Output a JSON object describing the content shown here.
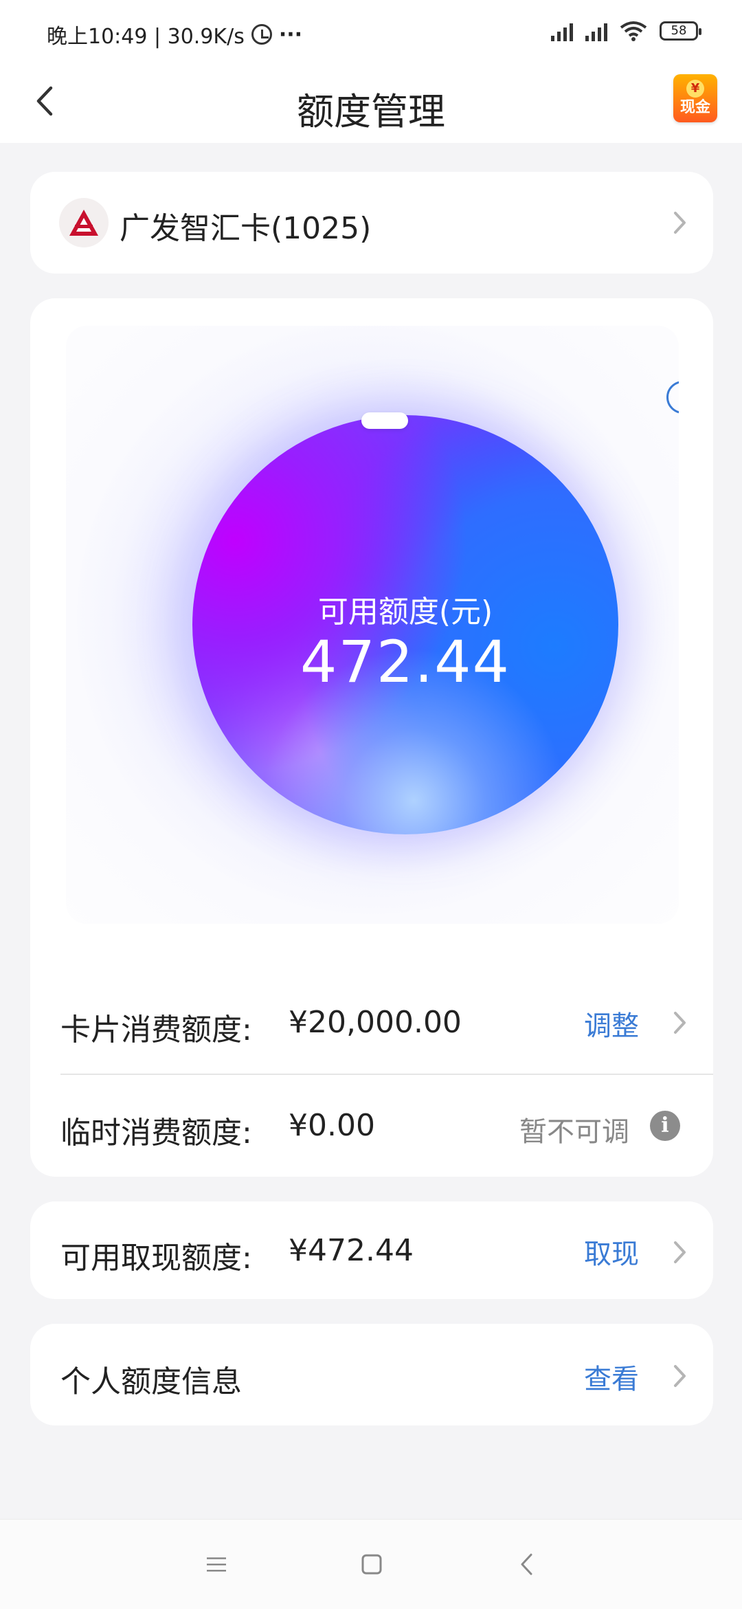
{
  "status_bar": {
    "time_speed": "晚上10:49 | 30.9K/s",
    "more": "···",
    "battery": "58",
    "icons": [
      "alarm-icon",
      "signal-icon",
      "signal-icon",
      "wifi-icon",
      "battery-icon"
    ]
  },
  "header": {
    "title": "额度管理",
    "back_icon": "chevron-left-icon",
    "cash_badge": {
      "coin": "¥",
      "label": "现金"
    }
  },
  "card_selector": {
    "bank_name": "广发智汇卡(1025)",
    "logo_icon": "cgb-bank-logo"
  },
  "credit_ball": {
    "label": "可用额度(元)",
    "value": "472.44",
    "help_icon": "?"
  },
  "limits": [
    {
      "label": "卡片消费额度:",
      "value": "¥20,000.00",
      "action": "调整"
    },
    {
      "label": "临时消费额度:",
      "value": "¥0.00",
      "action": "暂不可调",
      "info_icon": "i"
    }
  ],
  "cash_withdrawal": {
    "label": "可用取现额度:",
    "value": "¥472.44",
    "action": "取现"
  },
  "personal_info": {
    "label": "个人额度信息",
    "action": "查看"
  },
  "colors": {
    "accent": "#3a7bd5",
    "muted": "#888888",
    "background": "#f4f4f6"
  }
}
